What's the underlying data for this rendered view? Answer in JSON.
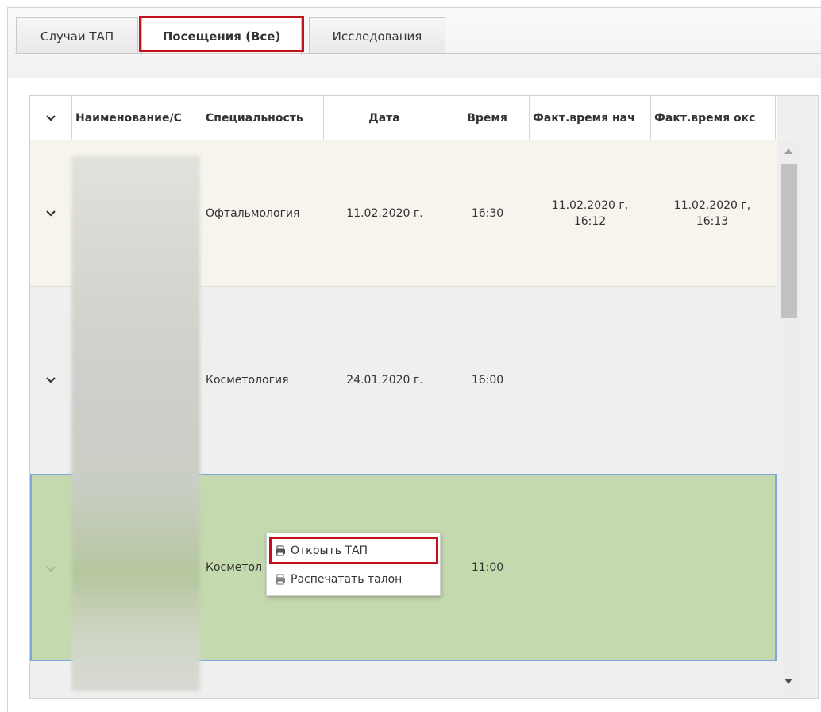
{
  "tabs": [
    {
      "label": "Случаи ТАП"
    },
    {
      "label": "Посещения (Все)"
    },
    {
      "label": "Исследования"
    }
  ],
  "columns": [
    "",
    "Наименование/С",
    "Специальность",
    "Дата",
    "Время",
    "Факт.время нач",
    "Факт.время окс"
  ],
  "rows": [
    {
      "specialty": "Офтальмология",
      "date": "11.02.2020 г.",
      "time": "16:30",
      "fact_start": "11.02.2020 г, 16:12",
      "fact_end": "11.02.2020 г, 16:13"
    },
    {
      "specialty": "Косметология",
      "date": "24.01.2020 г.",
      "time": "16:00",
      "fact_start": "",
      "fact_end": ""
    },
    {
      "specialty": "Косметол",
      "date": "",
      "time": "11:00",
      "fact_start": "",
      "fact_end": ""
    }
  ],
  "context_menu": {
    "items": [
      {
        "label": "Открыть ТАП",
        "icon": "printer-icon"
      },
      {
        "label": "Распечатать талон",
        "icon": "printer-icon"
      }
    ]
  },
  "colors": {
    "active_highlight": "#c0121b",
    "selected_row": "#c5d9ae",
    "selected_row_border": "#7fa6d6"
  }
}
